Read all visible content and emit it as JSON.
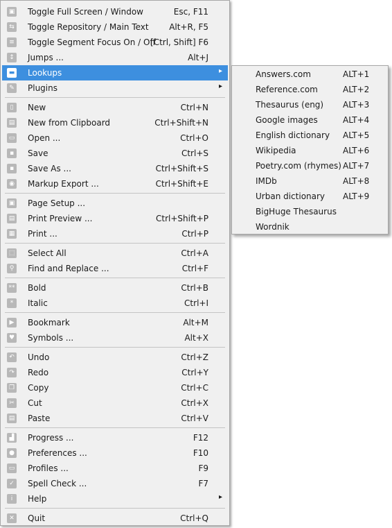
{
  "menu": {
    "items": [
      {
        "label": "Toggle Full Screen / Window",
        "shortcut": "Esc, F11",
        "icon": "fullscreen-icon",
        "glyph": "▣"
      },
      {
        "label": "Toggle Repository / Main Text",
        "shortcut": "Alt+R, F5",
        "icon": "swap-icon",
        "glyph": "⇆"
      },
      {
        "label": "Toggle Segment Focus On / Off",
        "shortcut": "[Ctrl, Shift] F6",
        "icon": "segment-focus-icon",
        "glyph": "≡"
      },
      {
        "label": "Jumps ...",
        "shortcut": "Alt+J",
        "icon": "jump-icon",
        "glyph": "↕"
      },
      {
        "label": "Lookups",
        "shortcut": "",
        "icon": "speech-bubble-icon",
        "glyph": "▬",
        "arrow": "▸",
        "highlighted": true
      },
      {
        "label": "Plugins",
        "shortcut": "",
        "icon": "wrench-icon",
        "glyph": "✎",
        "arrow": "▸"
      },
      {
        "label": "New",
        "shortcut": "Ctrl+N",
        "icon": "new-document-icon",
        "glyph": "▯"
      },
      {
        "label": "New from Clipboard",
        "shortcut": "Ctrl+Shift+N",
        "icon": "clipboard-document-icon",
        "glyph": "▤"
      },
      {
        "label": "Open ...",
        "shortcut": "Ctrl+O",
        "icon": "folder-open-icon",
        "glyph": "▭"
      },
      {
        "label": "Save",
        "shortcut": "Ctrl+S",
        "icon": "save-icon",
        "glyph": "▪"
      },
      {
        "label": "Save As ...",
        "shortcut": "Ctrl+Shift+S",
        "icon": "save-as-icon",
        "glyph": "▪"
      },
      {
        "label": "Markup Export ...",
        "shortcut": "Ctrl+Shift+E",
        "icon": "eye-icon",
        "glyph": "◉"
      },
      {
        "label": "Page Setup ...",
        "shortcut": "",
        "icon": "page-setup-icon",
        "glyph": "▣"
      },
      {
        "label": "Print Preview ...",
        "shortcut": "Ctrl+Shift+P",
        "icon": "print-preview-icon",
        "glyph": "▤"
      },
      {
        "label": "Print ...",
        "shortcut": "Ctrl+P",
        "icon": "printer-icon",
        "glyph": "▦"
      },
      {
        "label": "Select All",
        "shortcut": "Ctrl+A",
        "icon": "select-all-icon",
        "glyph": "⬚"
      },
      {
        "label": "Find and Replace ...",
        "shortcut": "Ctrl+F",
        "icon": "magnifier-icon",
        "glyph": "⚲"
      },
      {
        "label": "Bold",
        "shortcut": "Ctrl+B",
        "icon": "bold-icon",
        "glyph": "**"
      },
      {
        "label": "Italic",
        "shortcut": "Ctrl+I",
        "icon": "italic-icon",
        "glyph": "*"
      },
      {
        "label": "Bookmark",
        "shortcut": "Alt+M",
        "icon": "bookmark-icon",
        "glyph": "▶"
      },
      {
        "label": "Symbols ...",
        "shortcut": "Alt+X",
        "icon": "heart-icon",
        "glyph": "♥"
      },
      {
        "label": "Undo",
        "shortcut": "Ctrl+Z",
        "icon": "undo-icon",
        "glyph": "↶"
      },
      {
        "label": "Redo",
        "shortcut": "Ctrl+Y",
        "icon": "redo-icon",
        "glyph": "↷"
      },
      {
        "label": "Copy",
        "shortcut": "Ctrl+C",
        "icon": "copy-icon",
        "glyph": "❐"
      },
      {
        "label": "Cut",
        "shortcut": "Ctrl+X",
        "icon": "cut-icon",
        "glyph": "✂"
      },
      {
        "label": "Paste",
        "shortcut": "Ctrl+V",
        "icon": "paste-icon",
        "glyph": "▤"
      },
      {
        "label": "Progress ...",
        "shortcut": "F12",
        "icon": "progress-chart-icon",
        "glyph": "▟"
      },
      {
        "label": "Preferences ...",
        "shortcut": "F10",
        "icon": "user-icon",
        "glyph": "●"
      },
      {
        "label": "Profiles ...",
        "shortcut": "F9",
        "icon": "profile-card-icon",
        "glyph": "▭"
      },
      {
        "label": "Spell Check ...",
        "shortcut": "F7",
        "icon": "checkmark-icon",
        "glyph": "✓"
      },
      {
        "label": "Help",
        "shortcut": "",
        "icon": "info-icon",
        "glyph": "i",
        "arrow": "▸"
      },
      {
        "label": "Quit",
        "shortcut": "Ctrl+Q",
        "icon": "close-x-icon",
        "glyph": "✕"
      }
    ]
  },
  "submenu": {
    "items": [
      {
        "label": "Answers.com",
        "shortcut": "ALT+1"
      },
      {
        "label": "Reference.com",
        "shortcut": "ALT+2"
      },
      {
        "label": "Thesaurus (eng)",
        "shortcut": "ALT+3"
      },
      {
        "label": "Google images",
        "shortcut": "ALT+4"
      },
      {
        "label": "English dictionary",
        "shortcut": "ALT+5"
      },
      {
        "label": "Wikipedia",
        "shortcut": "ALT+6"
      },
      {
        "label": "Poetry.com (rhymes)",
        "shortcut": "ALT+7"
      },
      {
        "label": "IMDb",
        "shortcut": "ALT+8"
      },
      {
        "label": "Urban dictionary",
        "shortcut": "ALT+9"
      },
      {
        "label": "BigHuge Thesaurus",
        "shortcut": ""
      },
      {
        "label": "Wordnik",
        "shortcut": ""
      }
    ]
  },
  "colors": {
    "menu_bg": "#f0f0f0",
    "highlight": "#3d8fdf",
    "icon_gray": "#b8b8b8"
  }
}
